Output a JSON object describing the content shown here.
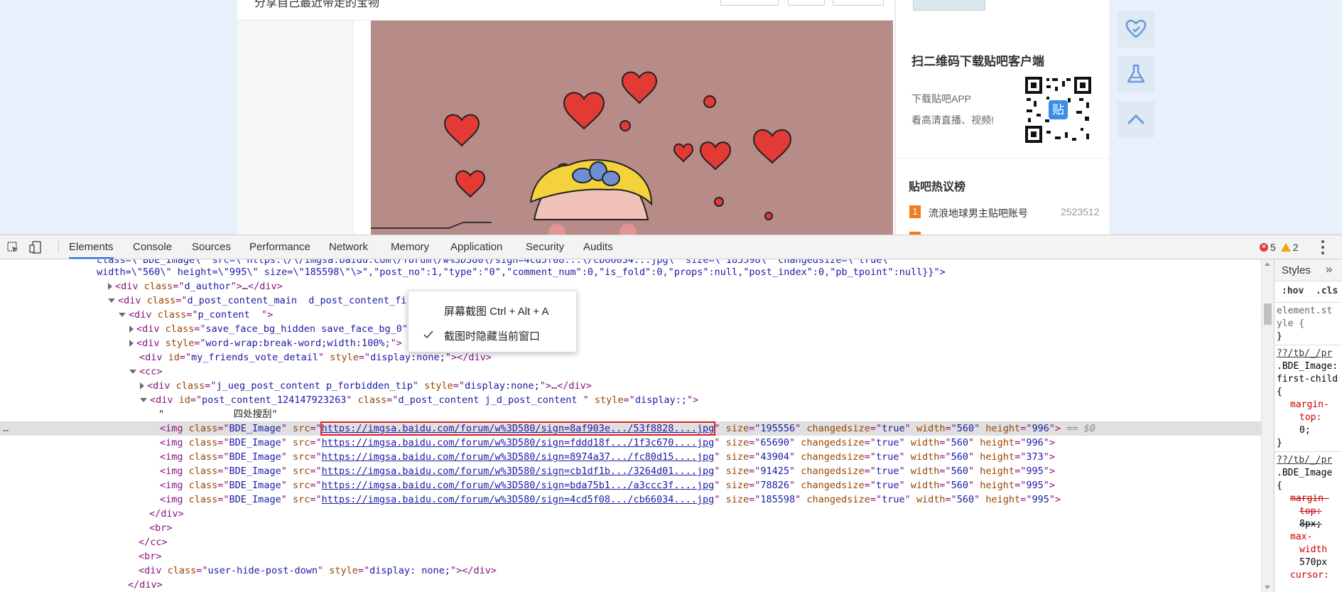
{
  "page": {
    "post_title": "分享自己最近带走的宝物",
    "qr": {
      "title": "扫二维码下载贴吧客户端",
      "line1": "下载贴吧APP",
      "line2": "看高清直播、视频!",
      "badge": "贴"
    },
    "hot": {
      "title": "贴吧热议榜",
      "rank": "1",
      "name": "流浪地球男主贴吧账号",
      "count": "2523512"
    }
  },
  "devtools": {
    "tabs": [
      "Elements",
      "Console",
      "Sources",
      "Performance",
      "Network",
      "Memory",
      "Application",
      "Security",
      "Audits"
    ],
    "active_tab": "Elements",
    "errors": "5",
    "warnings": "2",
    "dom": {
      "line0": "class=\\\"BDE_Image\\\" src=\\\"https:\\/\\/imgsa.baidu.com\\/forum\\/w%3D580\\/sign=4cd5f08...\\/cb66034...jpg\\\" size=\\\"185598\\\" changedsize=\\\"true\\\"",
      "line1_a": "width=\\\"560\\\" height=\\\"995\\\" size=\\\"185598\\\"\\>\",\"post_no\":1,\"type\":\"0\",\"comment_num\":0,\"is_fold\":0,\"props\":null,\"post_index\":0,\"pb_tpoint\":null}}\">",
      "d_author": "d_author",
      "main_class": "d_post_content_main  d_post_content_firstfloor",
      "p_content": "p_content  ",
      "save_face": "save_face_bg_hidden save_face_bg_0",
      "wordwrap": "word-wrap:break-word;width:100%;",
      "friends_id": "my_friends_vote_detail",
      "display_none": "display:none;",
      "cc": "cc",
      "ueg_class": "j_ueg_post_content p_forbidden_tip",
      "post_id": "post_content_124147923263",
      "post_class": "d_post_content j_d_post_content ",
      "post_style": "display:;",
      "text_node": "\"            四处搜刮\"",
      "hide_class": "user-hide-post-down",
      "hide_style": "display: none;",
      "eq": "== $0",
      "imgs": [
        {
          "url": "https://imgsa.baidu.com/forum/w%3D580/sign=8af903e.../53f8828....jpg",
          "size": "195556",
          "height": "996"
        },
        {
          "url": "https://imgsa.baidu.com/forum/w%3D580/sign=fddd18f.../1f3c670....jpg",
          "size": "65690",
          "height": "996"
        },
        {
          "url": "https://imgsa.baidu.com/forum/w%3D580/sign=8974a37.../fc80d15....jpg",
          "size": "43904",
          "height": "373"
        },
        {
          "url": "https://imgsa.baidu.com/forum/w%3D580/sign=cb1df1b.../3264d01....jpg",
          "size": "91425",
          "height": "995"
        },
        {
          "url": "https://imgsa.baidu.com/forum/w%3D580/sign=bda75b1.../a3ccc3f....jpg",
          "size": "78826",
          "height": "995"
        },
        {
          "url": "https://imgsa.baidu.com/forum/w%3D580/sign=4cd5f08.../cb66034....jpg",
          "size": "185598",
          "height": "995"
        }
      ]
    },
    "styles": {
      "tab": "Styles",
      "more": "»",
      "hov": ":hov",
      "cls": ".cls",
      "element_style_1": "element.st",
      "element_style_2": "yle {",
      "close": "}",
      "src1": "??/tb/_/pr",
      "sel1a": ".BDE_Image:",
      "sel1b": "first-child",
      "open": "{",
      "prop1a": "margin-",
      "prop1b": "top:",
      "val1": "0;",
      "src2": "??/tb/_/pr",
      "sel2": ".BDE_Image",
      "prop2a": "margin-",
      "prop2b": "top:",
      "val2": "8px;",
      "prop3a": "max-",
      "prop3b": "width",
      "val3": "570px",
      "prop4": "cursor:"
    }
  },
  "context_menu": {
    "item1": "屏幕截图 Ctrl + Alt + A",
    "item2": "截图时隐藏当前窗口"
  }
}
